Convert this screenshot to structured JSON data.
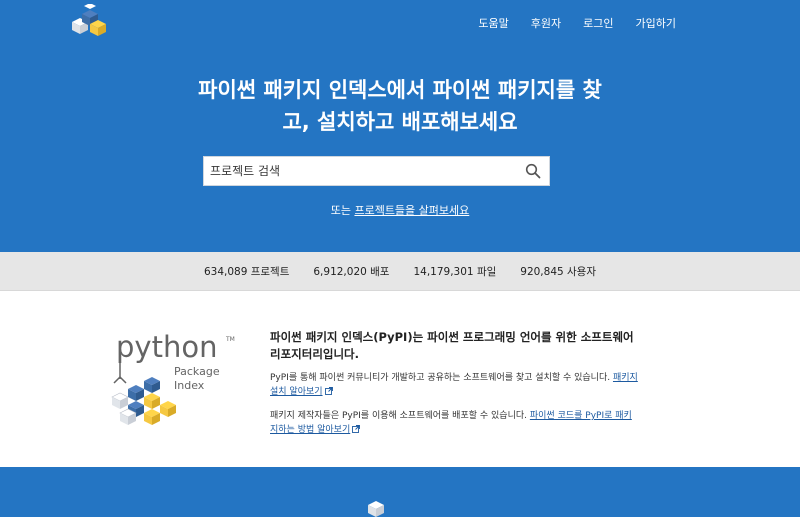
{
  "header": {
    "nav": [
      {
        "label": "도움말"
      },
      {
        "label": "후원자"
      },
      {
        "label": "로그인"
      },
      {
        "label": "가입하기"
      }
    ]
  },
  "hero": {
    "title_line1": "파이썬 패키지 인덱스에서 파이썬 패키지를 찾",
    "title_line2": "고, 설치하고 배포해보세요",
    "search_placeholder": "프로젝트 검색",
    "browse_prefix": "또는 ",
    "browse_link": "프로젝트들을 살펴보세요"
  },
  "stats": [
    {
      "label": "634,089 프로젝트"
    },
    {
      "label": "6,912,020 배포"
    },
    {
      "label": "14,179,301 파일"
    },
    {
      "label": "920,845 사용자"
    }
  ],
  "about": {
    "logo_word": "python",
    "logo_sub1": "Package",
    "logo_sub2": "Index",
    "logo_tm": "TM",
    "heading": "파이썬 패키지 인덱스(PyPI)는 파이썬 프로그래밍 언어를 위한 소프트웨어 리포지터리입니다.",
    "p1_text": "PyPI를 통해 파이썬 커뮤니티가 개발하고 공유하는 소프트웨어를 찾고 설치할 수 있습니다. ",
    "p1_link": "패키지 설치 알아보기",
    "p2_text": "패키지 제작자들은 PyPI를 이용해 소프트웨어를 배포할 수 있습니다. ",
    "p2_link": "파이썬 코드를 PyPI로 패키지하는 방법 알아보기"
  },
  "colors": {
    "brand_blue": "#2475c3",
    "stats_bg": "#e6e6e6",
    "link": "#1d5aa0",
    "python_blue": "#3d6ea8",
    "python_yellow": "#f5c842"
  }
}
